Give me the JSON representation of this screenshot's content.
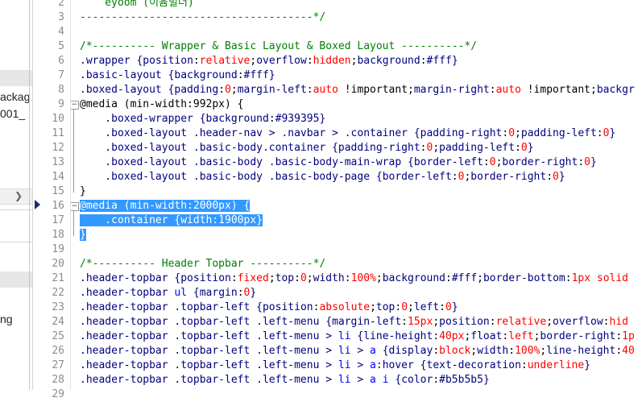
{
  "left_panel": {
    "texts": [
      "ackag",
      "001_",
      "ng"
    ]
  },
  "editor": {
    "lines": [
      {
        "n": "2",
        "segments": [
          {
            "t": "    eyoom (",
            "c": "c-comment"
          },
          {
            "t": "이윰빌더",
            "c": "c-comment"
          },
          {
            "t": ")",
            "c": "c-comment"
          }
        ]
      },
      {
        "n": "3",
        "segments": [
          {
            "t": "-------------------------------------*/",
            "c": "c-comment"
          }
        ]
      },
      {
        "n": "4",
        "segments": []
      },
      {
        "n": "5",
        "segments": [
          {
            "t": "/*---------- Wrapper & Basic Layout & Boxed Layout ----------*/",
            "c": "c-comment"
          }
        ]
      },
      {
        "n": "6",
        "segments": [
          {
            "t": ".wrapper {",
            "c": "c-sel"
          },
          {
            "t": "position",
            "c": "c-sel"
          },
          {
            "t": ":",
            "c": "c-plain"
          },
          {
            "t": "relative",
            "c": "c-prop"
          },
          {
            "t": ";",
            "c": "c-plain"
          },
          {
            "t": "overflow",
            "c": "c-sel"
          },
          {
            "t": ":",
            "c": "c-plain"
          },
          {
            "t": "hidden",
            "c": "c-prop"
          },
          {
            "t": ";",
            "c": "c-plain"
          },
          {
            "t": "background",
            "c": "c-sel"
          },
          {
            "t": ":",
            "c": "c-plain"
          },
          {
            "t": "#fff",
            "c": "c-sel"
          },
          {
            "t": "}",
            "c": "c-sel"
          }
        ]
      },
      {
        "n": "7",
        "segments": [
          {
            "t": ".basic-layout {",
            "c": "c-sel"
          },
          {
            "t": "background",
            "c": "c-sel"
          },
          {
            "t": ":",
            "c": "c-plain"
          },
          {
            "t": "#fff",
            "c": "c-sel"
          },
          {
            "t": "}",
            "c": "c-sel"
          }
        ]
      },
      {
        "n": "8",
        "segments": [
          {
            "t": ".boxed-layout {",
            "c": "c-sel"
          },
          {
            "t": "padding",
            "c": "c-sel"
          },
          {
            "t": ":",
            "c": "c-plain"
          },
          {
            "t": "0",
            "c": "c-prop"
          },
          {
            "t": ";",
            "c": "c-plain"
          },
          {
            "t": "margin-left",
            "c": "c-sel"
          },
          {
            "t": ":",
            "c": "c-plain"
          },
          {
            "t": "auto",
            "c": "c-prop"
          },
          {
            "t": " !important;",
            "c": "c-plain"
          },
          {
            "t": "margin-right",
            "c": "c-sel"
          },
          {
            "t": ":",
            "c": "c-plain"
          },
          {
            "t": "auto",
            "c": "c-prop"
          },
          {
            "t": " !important;",
            "c": "c-plain"
          },
          {
            "t": "backgr",
            "c": "c-sel"
          }
        ]
      },
      {
        "n": "9",
        "fold": "-",
        "segments": [
          {
            "t": "@media (min-width:992px) {",
            "c": "c-plain"
          }
        ]
      },
      {
        "n": "10",
        "segments": [
          {
            "t": "    .boxed-wrapper {",
            "c": "c-sel"
          },
          {
            "t": "background",
            "c": "c-sel"
          },
          {
            "t": ":",
            "c": "c-plain"
          },
          {
            "t": "#939395",
            "c": "c-sel"
          },
          {
            "t": "}",
            "c": "c-sel"
          }
        ]
      },
      {
        "n": "11",
        "segments": [
          {
            "t": "    .boxed-layout .header-nav > .navbar > .container {",
            "c": "c-sel"
          },
          {
            "t": "padding-right",
            "c": "c-sel"
          },
          {
            "t": ":",
            "c": "c-plain"
          },
          {
            "t": "0",
            "c": "c-prop"
          },
          {
            "t": ";",
            "c": "c-plain"
          },
          {
            "t": "padding-left",
            "c": "c-sel"
          },
          {
            "t": ":",
            "c": "c-plain"
          },
          {
            "t": "0",
            "c": "c-prop"
          },
          {
            "t": "}",
            "c": "c-sel"
          }
        ]
      },
      {
        "n": "12",
        "segments": [
          {
            "t": "    .boxed-layout .basic-body.container {",
            "c": "c-sel"
          },
          {
            "t": "padding-right",
            "c": "c-sel"
          },
          {
            "t": ":",
            "c": "c-plain"
          },
          {
            "t": "0",
            "c": "c-prop"
          },
          {
            "t": ";",
            "c": "c-plain"
          },
          {
            "t": "padding-left",
            "c": "c-sel"
          },
          {
            "t": ":",
            "c": "c-plain"
          },
          {
            "t": "0",
            "c": "c-prop"
          },
          {
            "t": "}",
            "c": "c-sel"
          }
        ]
      },
      {
        "n": "13",
        "segments": [
          {
            "t": "    .boxed-layout .basic-body .basic-body-main-wrap {",
            "c": "c-sel"
          },
          {
            "t": "border-left",
            "c": "c-sel"
          },
          {
            "t": ":",
            "c": "c-plain"
          },
          {
            "t": "0",
            "c": "c-prop"
          },
          {
            "t": ";",
            "c": "c-plain"
          },
          {
            "t": "border-right",
            "c": "c-sel"
          },
          {
            "t": ":",
            "c": "c-plain"
          },
          {
            "t": "0",
            "c": "c-prop"
          },
          {
            "t": "}",
            "c": "c-sel"
          }
        ]
      },
      {
        "n": "14",
        "segments": [
          {
            "t": "    .boxed-layout .basic-body .basic-body-page {",
            "c": "c-sel"
          },
          {
            "t": "border-left",
            "c": "c-sel"
          },
          {
            "t": ":",
            "c": "c-plain"
          },
          {
            "t": "0",
            "c": "c-prop"
          },
          {
            "t": ";",
            "c": "c-plain"
          },
          {
            "t": "border-right",
            "c": "c-sel"
          },
          {
            "t": ":",
            "c": "c-plain"
          },
          {
            "t": "0",
            "c": "c-prop"
          },
          {
            "t": "}",
            "c": "c-sel"
          }
        ]
      },
      {
        "n": "15",
        "segments": [
          {
            "t": "}",
            "c": "c-plain"
          }
        ]
      },
      {
        "n": "16",
        "fold": "-",
        "sel": true,
        "segments": [
          {
            "t": "@media (min-width:2000px) {",
            "c": "sel"
          }
        ]
      },
      {
        "n": "17",
        "sel": true,
        "segments": [
          {
            "t": "    .container {width:1900px}",
            "c": "sel"
          }
        ]
      },
      {
        "n": "18",
        "sel": true,
        "segments": [
          {
            "t": "}",
            "c": "sel"
          }
        ]
      },
      {
        "n": "19",
        "segments": []
      },
      {
        "n": "20",
        "segments": [
          {
            "t": "/*---------- Header Topbar ----------*/",
            "c": "c-comment"
          }
        ]
      },
      {
        "n": "21",
        "segments": [
          {
            "t": ".header-topbar {",
            "c": "c-sel"
          },
          {
            "t": "position",
            "c": "c-sel"
          },
          {
            "t": ":",
            "c": "c-plain"
          },
          {
            "t": "fixed",
            "c": "c-prop"
          },
          {
            "t": ";",
            "c": "c-plain"
          },
          {
            "t": "top",
            "c": "c-sel"
          },
          {
            "t": ":",
            "c": "c-plain"
          },
          {
            "t": "0",
            "c": "c-prop"
          },
          {
            "t": ";",
            "c": "c-plain"
          },
          {
            "t": "width",
            "c": "c-sel"
          },
          {
            "t": ":",
            "c": "c-plain"
          },
          {
            "t": "100%",
            "c": "c-prop"
          },
          {
            "t": ";",
            "c": "c-plain"
          },
          {
            "t": "background",
            "c": "c-sel"
          },
          {
            "t": ":",
            "c": "c-plain"
          },
          {
            "t": "#fff",
            "c": "c-sel"
          },
          {
            "t": ";",
            "c": "c-plain"
          },
          {
            "t": "border-bottom",
            "c": "c-sel"
          },
          {
            "t": ":",
            "c": "c-plain"
          },
          {
            "t": "1px solid",
            "c": "c-prop"
          }
        ]
      },
      {
        "n": "22",
        "segments": [
          {
            "t": ".header-topbar ",
            "c": "c-sel"
          },
          {
            "t": "ul",
            "c": "c-val"
          },
          {
            "t": " {",
            "c": "c-sel"
          },
          {
            "t": "margin",
            "c": "c-sel"
          },
          {
            "t": ":",
            "c": "c-plain"
          },
          {
            "t": "0",
            "c": "c-prop"
          },
          {
            "t": "}",
            "c": "c-sel"
          }
        ]
      },
      {
        "n": "23",
        "segments": [
          {
            "t": ".header-topbar .topbar-left {",
            "c": "c-sel"
          },
          {
            "t": "position",
            "c": "c-sel"
          },
          {
            "t": ":",
            "c": "c-plain"
          },
          {
            "t": "absolute",
            "c": "c-prop"
          },
          {
            "t": ";",
            "c": "c-plain"
          },
          {
            "t": "top",
            "c": "c-sel"
          },
          {
            "t": ":",
            "c": "c-plain"
          },
          {
            "t": "0",
            "c": "c-prop"
          },
          {
            "t": ";",
            "c": "c-plain"
          },
          {
            "t": "left",
            "c": "c-sel"
          },
          {
            "t": ":",
            "c": "c-plain"
          },
          {
            "t": "0",
            "c": "c-prop"
          },
          {
            "t": "}",
            "c": "c-sel"
          }
        ]
      },
      {
        "n": "24",
        "segments": [
          {
            "t": ".header-topbar .topbar-left .left-menu {",
            "c": "c-sel"
          },
          {
            "t": "margin-left",
            "c": "c-sel"
          },
          {
            "t": ":",
            "c": "c-plain"
          },
          {
            "t": "15px",
            "c": "c-prop"
          },
          {
            "t": ";",
            "c": "c-plain"
          },
          {
            "t": "position",
            "c": "c-sel"
          },
          {
            "t": ":",
            "c": "c-plain"
          },
          {
            "t": "relative",
            "c": "c-prop"
          },
          {
            "t": ";",
            "c": "c-plain"
          },
          {
            "t": "overflow",
            "c": "c-sel"
          },
          {
            "t": ":",
            "c": "c-plain"
          },
          {
            "t": "hid",
            "c": "c-prop"
          }
        ]
      },
      {
        "n": "25",
        "segments": [
          {
            "t": ".header-topbar .topbar-left .left-menu > ",
            "c": "c-sel"
          },
          {
            "t": "li",
            "c": "c-val"
          },
          {
            "t": " {",
            "c": "c-sel"
          },
          {
            "t": "line-height",
            "c": "c-sel"
          },
          {
            "t": ":",
            "c": "c-plain"
          },
          {
            "t": "40px",
            "c": "c-prop"
          },
          {
            "t": ";",
            "c": "c-plain"
          },
          {
            "t": "float",
            "c": "c-sel"
          },
          {
            "t": ":",
            "c": "c-plain"
          },
          {
            "t": "left",
            "c": "c-prop"
          },
          {
            "t": ";",
            "c": "c-plain"
          },
          {
            "t": "border-right",
            "c": "c-sel"
          },
          {
            "t": ":",
            "c": "c-plain"
          },
          {
            "t": "1p",
            "c": "c-prop"
          }
        ]
      },
      {
        "n": "26",
        "segments": [
          {
            "t": ".header-topbar .topbar-left .left-menu > ",
            "c": "c-sel"
          },
          {
            "t": "li",
            "c": "c-val"
          },
          {
            "t": " > ",
            "c": "c-sel"
          },
          {
            "t": "a",
            "c": "c-val"
          },
          {
            "t": " {",
            "c": "c-sel"
          },
          {
            "t": "display",
            "c": "c-sel"
          },
          {
            "t": ":",
            "c": "c-plain"
          },
          {
            "t": "block",
            "c": "c-prop"
          },
          {
            "t": ";",
            "c": "c-plain"
          },
          {
            "t": "width",
            "c": "c-sel"
          },
          {
            "t": ":",
            "c": "c-plain"
          },
          {
            "t": "100%",
            "c": "c-prop"
          },
          {
            "t": ";",
            "c": "c-plain"
          },
          {
            "t": "line-height",
            "c": "c-sel"
          },
          {
            "t": ":",
            "c": "c-plain"
          },
          {
            "t": "40",
            "c": "c-prop"
          }
        ]
      },
      {
        "n": "27",
        "segments": [
          {
            "t": ".header-topbar .topbar-left .left-menu > ",
            "c": "c-sel"
          },
          {
            "t": "li",
            "c": "c-val"
          },
          {
            "t": " > ",
            "c": "c-sel"
          },
          {
            "t": "a",
            "c": "c-val"
          },
          {
            "t": ":hover {",
            "c": "c-sel"
          },
          {
            "t": "text-decoration",
            "c": "c-sel"
          },
          {
            "t": ":",
            "c": "c-plain"
          },
          {
            "t": "underline",
            "c": "c-prop"
          },
          {
            "t": "}",
            "c": "c-sel"
          }
        ]
      },
      {
        "n": "28",
        "segments": [
          {
            "t": ".header-topbar .topbar-left .left-menu > ",
            "c": "c-sel"
          },
          {
            "t": "li",
            "c": "c-val"
          },
          {
            "t": " > ",
            "c": "c-sel"
          },
          {
            "t": "a",
            "c": "c-val"
          },
          {
            "t": " ",
            "c": "c-sel"
          },
          {
            "t": "i",
            "c": "c-val"
          },
          {
            "t": " {",
            "c": "c-sel"
          },
          {
            "t": "color",
            "c": "c-sel"
          },
          {
            "t": ":",
            "c": "c-plain"
          },
          {
            "t": "#b5b5b5",
            "c": "c-sel"
          },
          {
            "t": "}",
            "c": "c-sel"
          }
        ]
      },
      {
        "n": "29",
        "segments": []
      }
    ]
  },
  "colors": {
    "selection": "#3399ff",
    "bookmark": "#1c2a6b",
    "comment": "#008000",
    "value": "#ff0000",
    "selector": "#00007f"
  }
}
